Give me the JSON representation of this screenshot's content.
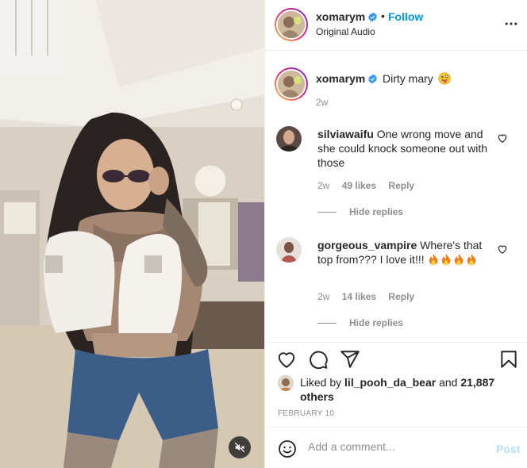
{
  "post": {
    "username": "xomarym",
    "separator": "•",
    "follow_label": "Follow",
    "audio_label": "Original Audio",
    "caption_text": "Dirty mary",
    "caption_time": "2w"
  },
  "comments": [
    {
      "username": "silviawaifu",
      "text": "One wrong move and she could knock someone out with those",
      "time": "2w",
      "likes": "49 likes",
      "reply_label": "Reply",
      "hide_replies_label": "Hide replies"
    },
    {
      "username": "gorgeous_vampire",
      "text": "Where's that top from??? I love it!!!",
      "time": "2w",
      "likes": "14 likes",
      "reply_label": "Reply",
      "hide_replies_label": "Hide replies"
    }
  ],
  "likes": {
    "prefix": "Liked by",
    "user": "lil_pooh_da_bear",
    "conjunction": "and",
    "others": "21,887 others"
  },
  "date": "FEBRUARY 10",
  "comment_box": {
    "placeholder": "Add a comment...",
    "post_label": "Post"
  },
  "colors": {
    "link_blue": "#0095f6",
    "post_disabled": "#b2dffc",
    "muted_text": "#8e8e8e",
    "text": "#262626"
  },
  "icons": [
    "verified-badge-icon",
    "more-options-icon",
    "heart-icon",
    "comment-icon",
    "share-icon",
    "save-icon",
    "emoji-icon",
    "fire-icon",
    "mute-icon"
  ]
}
